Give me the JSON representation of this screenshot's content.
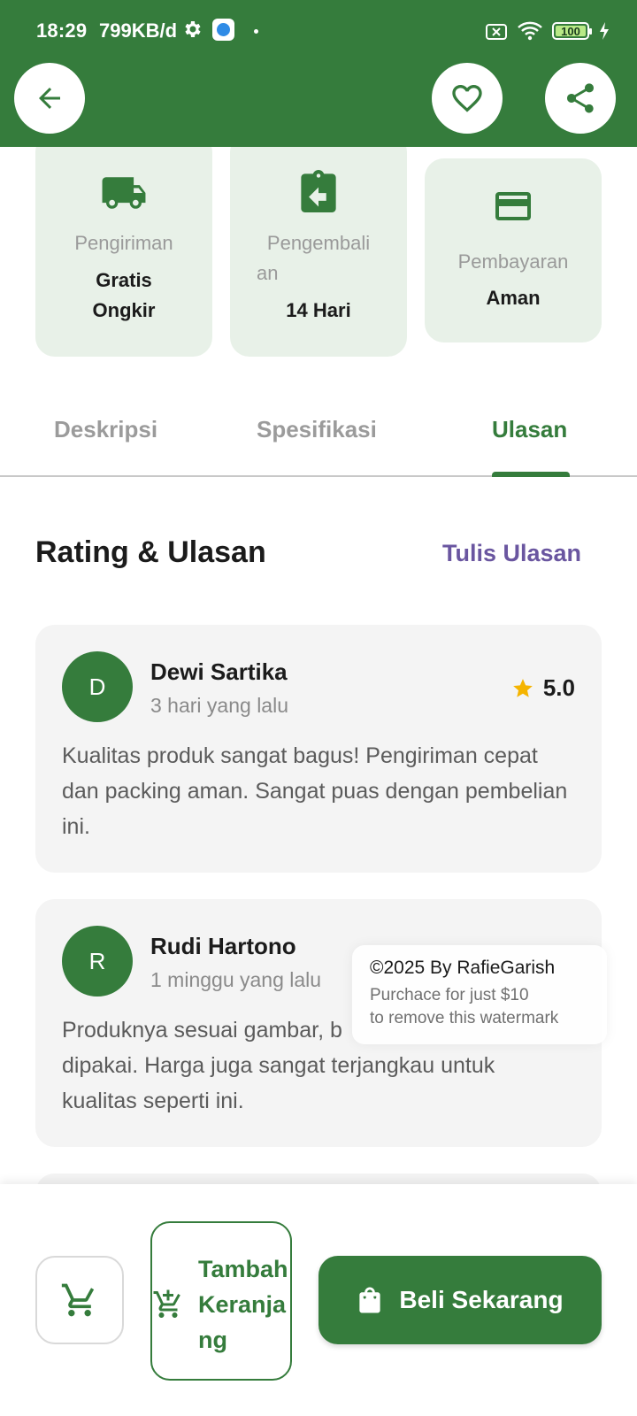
{
  "status_bar": {
    "time": "18:29",
    "net_speed": "799KB/d",
    "battery": "100"
  },
  "colors": {
    "primary": "#357c3c",
    "card_bg": "#e8f1e8",
    "link": "#6a56a0",
    "star": "#f5b400"
  },
  "header": {
    "back_icon": "arrow-back-icon",
    "favorite_icon": "heart-outline-icon",
    "share_icon": "share-icon"
  },
  "features": [
    {
      "icon": "truck-icon",
      "label": "Pengiriman",
      "value_line1": "Gratis",
      "value_line2": "Ongkir"
    },
    {
      "icon": "return-icon",
      "label_line1": "Pengembali",
      "label_line2": "an",
      "value": "14 Hari"
    },
    {
      "icon": "credit-card-icon",
      "label": "Pembayaran",
      "value": "Aman"
    }
  ],
  "tabs": [
    {
      "label": "Deskripsi",
      "active": false
    },
    {
      "label": "Spesifikasi",
      "active": false
    },
    {
      "label": "Ulasan",
      "active": true
    }
  ],
  "reviews_section": {
    "title": "Rating & Ulasan",
    "write_review": "Tulis Ulasan"
  },
  "reviews": [
    {
      "initial": "D",
      "name": "Dewi Sartika",
      "time": "3 hari yang lalu",
      "rating": "5.0",
      "text": "Kualitas produk sangat bagus! Pengiriman cepat dan packing aman. Sangat puas dengan pembelian ini."
    },
    {
      "initial": "R",
      "name": "Rudi Hartono",
      "time": "1 minggu yang lalu",
      "text_partial_line1": "Produknya sesuai gambar, b",
      "text_line2": "dipakai. Harga juga sangat terjangkau untuk",
      "text_line3": "kualitas seperti ini."
    }
  ],
  "watermark": {
    "title": "©2025 By RafieGarish",
    "line1": "Purchace for just $10",
    "line2": "to remove this watermark"
  },
  "bottom_bar": {
    "cart_icon": "cart-icon",
    "add_to_cart_label": "Tambah Keranjang",
    "buy_now_label": "Beli Sekarang",
    "buy_icon": "shopping-bag-icon"
  }
}
